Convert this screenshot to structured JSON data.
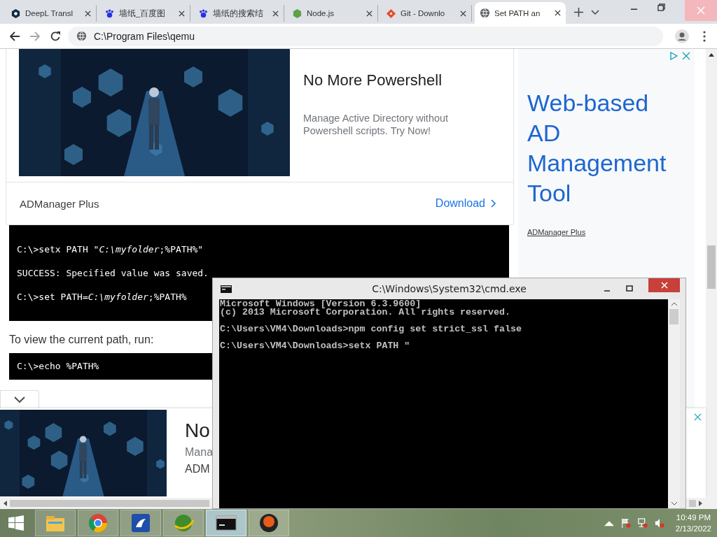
{
  "browser": {
    "tabs": [
      {
        "title": "DeepL Transl",
        "selected": false
      },
      {
        "title": "墙纸_百度图",
        "selected": false
      },
      {
        "title": "墙纸的搜索结",
        "selected": false
      },
      {
        "title": "Node.js",
        "selected": false
      },
      {
        "title": "Git - Downlo",
        "selected": false
      },
      {
        "title": "Set PATH an",
        "selected": true
      }
    ],
    "address": {
      "url": "C:\\Program Files\\qemu"
    }
  },
  "page": {
    "top_ad": {
      "title": "No More Powershell",
      "description": "Manage Active Directory without Powershell scripts. Try Now!",
      "advertiser": "ADManager Plus",
      "cta": "Download"
    },
    "code_block_1": [
      "C:\\>setx PATH \"*C:\\myfolder*;%PATH%\"",
      "SUCCESS: Specified value was saved.",
      "C:\\>set PATH=*C:\\myfolder*;%PATH%"
    ],
    "paragraph": "To view the current path, run:",
    "code_block_2": [
      "C:\\>echo %PATH%"
    ],
    "side_ad": {
      "headline": "Web-based AD Management Tool",
      "advertiser": "ADManager Plus"
    },
    "bottom_ad": {
      "title": "No",
      "description": "Mana",
      "advertiser": "ADM"
    }
  },
  "cmd_window": {
    "title": "C:\\Windows\\System32\\cmd.exe",
    "console": [
      [
        "Microsoft Windows [Version 6.3.9600]",
        "(c) 2013 Microsoft Corporation. All rights reserved."
      ],
      [
        "C:\\Users\\VM4\\Downloads>npm config set strict_ssl false"
      ],
      [
        "C:\\Users\\VM4\\Downloads>setx PATH \""
      ]
    ]
  },
  "taskbar": {
    "apps": [
      {
        "selected": false
      },
      {
        "selected": false
      },
      {
        "selected": false
      },
      {
        "selected": false
      },
      {
        "selected": true
      },
      {
        "selected": false
      }
    ],
    "time": "10:49 PM",
    "date": "2/13/2022"
  }
}
